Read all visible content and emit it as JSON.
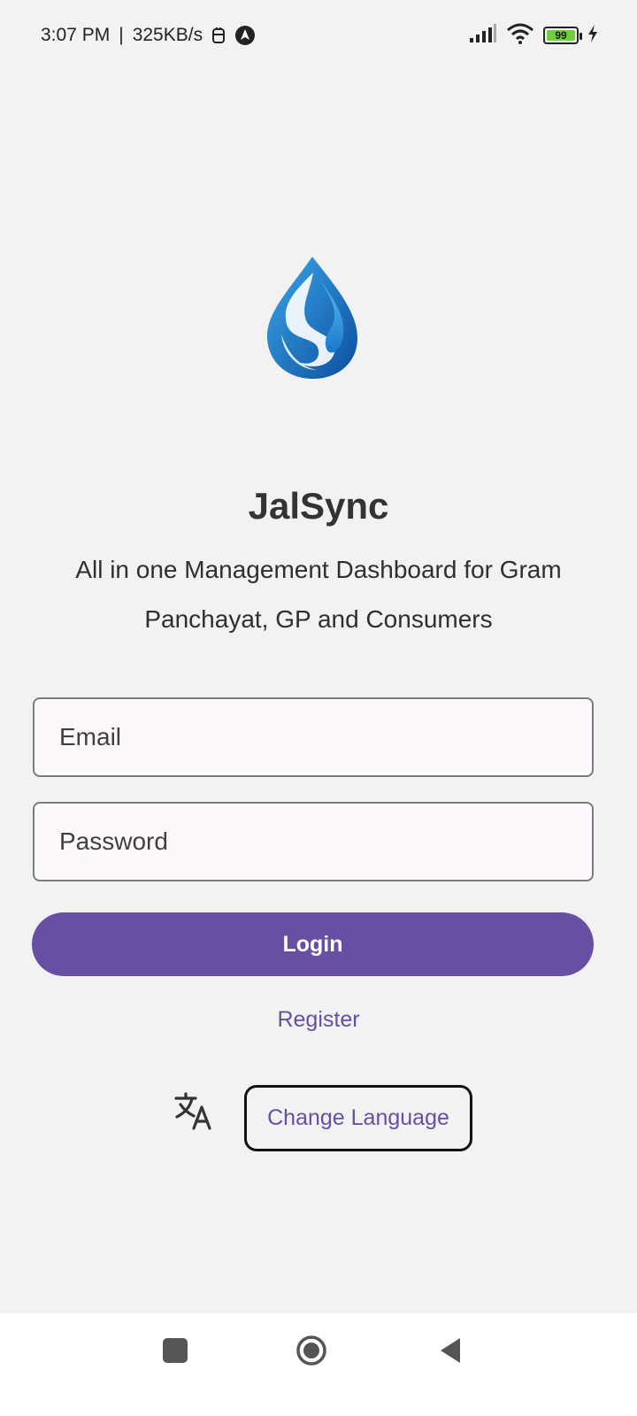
{
  "status_bar": {
    "time": "3:07 PM",
    "separator": "|",
    "speed": "325KB/s",
    "battery_level": "99",
    "icons": [
      "sim-icon",
      "navigation-app-icon",
      "signal-icon",
      "wifi-icon",
      "battery-icon",
      "charging-icon"
    ]
  },
  "app": {
    "title": "JalSync",
    "subtitle": "All in one Management Dashboard for Gram Panchayat, GP and Consumers",
    "logo_icon": "water-drop-logo"
  },
  "form": {
    "email_placeholder": "Email",
    "password_placeholder": "Password",
    "login_label": "Login",
    "register_label": "Register",
    "change_language_label": "Change Language",
    "translate_icon": "translate-icon"
  },
  "nav_bar": {
    "icons": [
      "recents-icon",
      "home-icon",
      "back-icon"
    ]
  },
  "colors": {
    "accent": "#6750a4",
    "background": "#f2f2f2",
    "field_background": "#fdf8fc",
    "logo_dark_blue": "#0d5fb0",
    "logo_light_blue": "#3aa6e8"
  }
}
